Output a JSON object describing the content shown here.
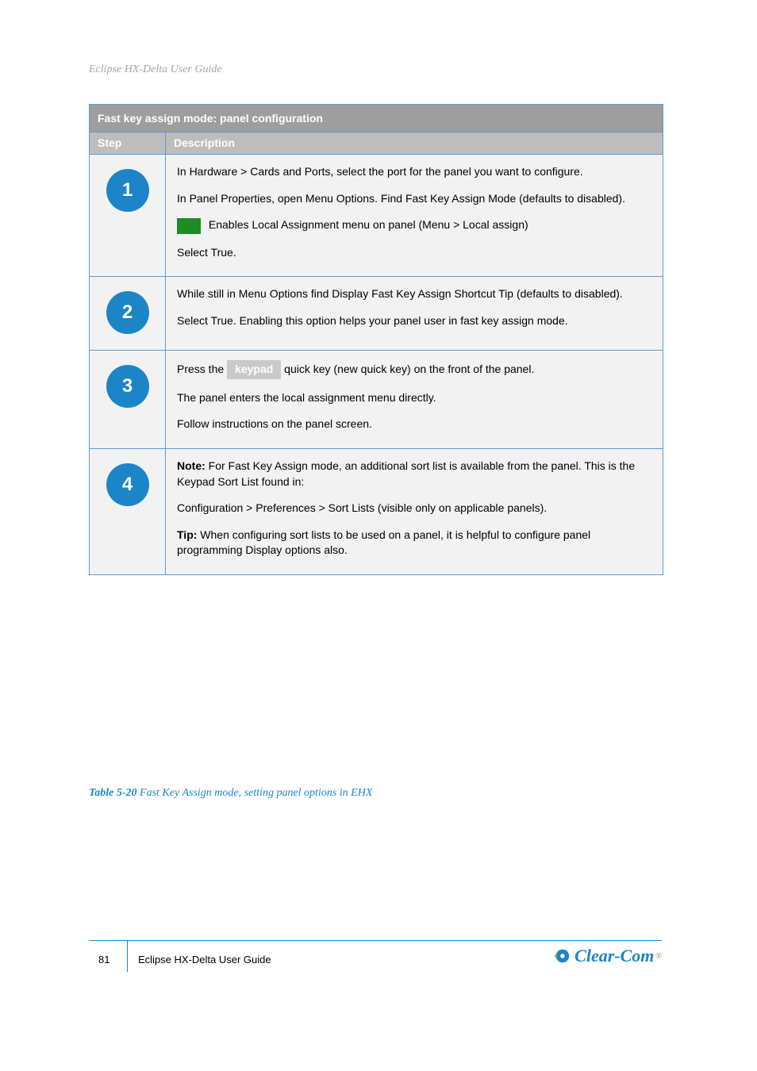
{
  "header": {
    "text": "Eclipse HX-Delta User Guide"
  },
  "table": {
    "title": "Fast key assign mode: panel configuration",
    "columns": {
      "step": "Step",
      "desc": "Description"
    },
    "rows": [
      {
        "num": "1",
        "paragraphs": [
          "In Hardware > Cards and Ports, select the port for the panel you want to configure.",
          "In Panel Properties, open Menu Options. Find Fast Key Assign Mode (defaults to disabled)."
        ],
        "swatch_note": "Enables Local Assignment menu on panel (Menu > Local assign)",
        "after_swatch": [
          "Select True."
        ]
      },
      {
        "num": "2",
        "paragraphs": [
          "While still in Menu Options find Display Fast Key Assign Shortcut Tip (defaults to disabled).",
          "Select True. Enabling this option helps your panel user in fast key assign mode."
        ]
      },
      {
        "num": "3",
        "keypad_label": "keypad",
        "before_btn": "Press the ",
        "after_btn": " quick key (new quick key) on the front of the panel.",
        "paragraphs_after": [
          "The panel enters the local assignment menu directly.",
          "Follow instructions on the panel screen."
        ]
      },
      {
        "num": "4",
        "note": {
          "label": "Note:",
          "text": " For Fast Key Assign mode, an additional sort list is available from the panel. This is the Keypad Sort List found in:"
        },
        "paragraphs": [
          "Configuration > Preferences > Sort Lists (visible only on applicable panels)."
        ],
        "tip": {
          "label": "Tip:",
          "text": " When configuring sort lists to be used on a panel, it is helpful to configure panel programming Display options also."
        }
      }
    ]
  },
  "caption": {
    "prefix": "Table 5-20",
    "rest": " Fast Key Assign mode, setting panel options in EHX"
  },
  "footer": {
    "page": "81",
    "doc": "Eclipse HX-Delta User Guide",
    "brand": "Clear-Com",
    "reg": "®"
  }
}
